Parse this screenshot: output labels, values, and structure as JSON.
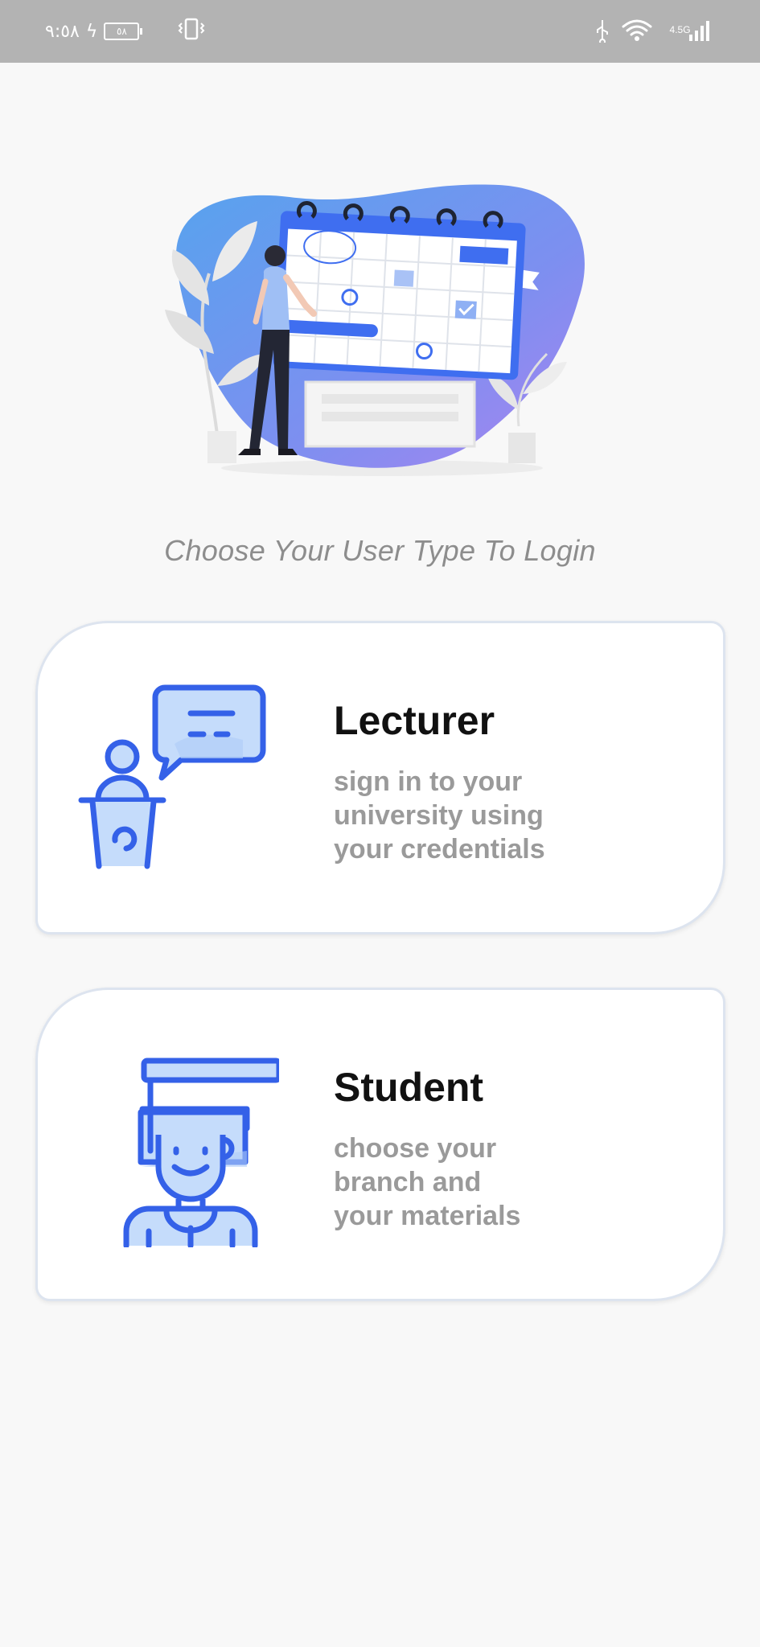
{
  "status_bar": {
    "time": "٩:٥٨",
    "battery": "٥٨",
    "network": "4.5G"
  },
  "hero": {
    "illustration": "calendar-planning-illustration"
  },
  "subtitle": "Choose Your User Type To Login",
  "cards": [
    {
      "title": "Lecturer",
      "description": "sign in to your\nuniversity using\nyour credentials",
      "icon": "lecturer-podium-icon"
    },
    {
      "title": "Student",
      "description": "choose your\nbranch and\nyour materials",
      "icon": "student-graduate-icon"
    }
  ],
  "colors": {
    "accent": "#3461e8",
    "accent_light": "#c5dcfb",
    "title": "#111111",
    "description": "#9a9a9a",
    "subtitle": "#8d8d8d",
    "status_bar": "#b3b3b3"
  }
}
